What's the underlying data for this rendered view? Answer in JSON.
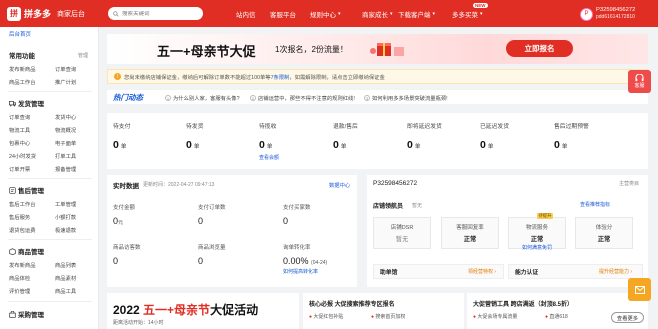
{
  "header": {
    "logo_mark": "拼",
    "logo_text": "拼多多",
    "logo_sub": "商家后台",
    "search_placeholder": "搜索关键词",
    "nav": [
      "站内信",
      "客服平台",
      "规则中心",
      "商家成长",
      "下载客户端",
      "多多买菜"
    ],
    "new_badge": "NEW",
    "user_name": "P32598456272",
    "user_sub": "pdd61614172810",
    "avatar": "P"
  },
  "sidebar": {
    "back_label": "后台首页",
    "manage_label": "管理",
    "common_title": "常用功能",
    "common_items": [
      "发布新商品",
      "订单查询",
      "商品工作台",
      "推广计划"
    ],
    "sections": [
      {
        "title": "发货管理",
        "items": [
          "订单查询",
          "发货中心",
          "物流工具",
          "物流概况",
          "包裹中心",
          "电子面单",
          "24小时发货",
          "打单工具",
          "订单开票",
          "报备管理"
        ]
      },
      {
        "title": "售后管理",
        "items": [
          "售后工作台",
          "工单管理",
          "售后服务",
          "小额打款",
          "退货包运费",
          "极速退款"
        ]
      },
      {
        "title": "商品管理",
        "items": [
          "发布新商品",
          "商品列表",
          "商品体检",
          "商品素材",
          "评价管理",
          "商品工具"
        ]
      },
      {
        "title": "采购管理",
        "items": []
      }
    ]
  },
  "banner": {
    "title": "五一+母亲节大促",
    "subtitle": "1次报名，2份流量！",
    "button": "立即报名"
  },
  "notice": {
    "text": "您尚未缴纳店铺保证金，缴纳后可解除订单数不能超过100单等",
    "link1": "7条限制",
    "mid": "，如需解除限制，请点击立即缴纳保证金",
    "link2": "立即缴纳保证金"
  },
  "hot": {
    "label": "热门动态",
    "items": [
      "为什么别人家，客服有头像?",
      "店铺运营中，那些不得不注意的规则红线!",
      "如何利用多多场景突破流量瓶颈!"
    ]
  },
  "stats": [
    {
      "label": "待支付",
      "value": "0",
      "unit": "单"
    },
    {
      "label": "待发货",
      "value": "0",
      "unit": "单"
    },
    {
      "label": "待揽收",
      "value": "0",
      "unit": "单",
      "link": "查看会额"
    },
    {
      "label": "退款/售后",
      "value": "0",
      "unit": "单"
    },
    {
      "label": "即将延迟发货",
      "value": "0",
      "unit": "单"
    },
    {
      "label": "已延迟发货",
      "value": "0",
      "unit": "单"
    },
    {
      "label": "售后过期预警",
      "value": "0",
      "unit": "单"
    }
  ],
  "realtime": {
    "title": "实时数据",
    "updated": "更新时间：2022-04-27 09:47:13",
    "link": "数据中心",
    "cells": [
      {
        "label": "支付金额",
        "value": "0",
        "unit": "元"
      },
      {
        "label": "支付订单数",
        "value": "0",
        "unit": ""
      },
      {
        "label": "支付买家数",
        "value": "0",
        "unit": ""
      },
      {
        "label": "商品访客数",
        "value": "0",
        "unit": ""
      },
      {
        "label": "商品浏览量",
        "value": "0",
        "unit": ""
      },
      {
        "label": "询单转化率",
        "value": "0.00%",
        "unit": "(04-24)",
        "link": "如何提高转化率"
      }
    ]
  },
  "shop": {
    "account": "P32598456272",
    "account_tag": "主营类目",
    "sub_title": "店铺领航员",
    "sub_note": "暂无",
    "sub_link": "查看推荐指标",
    "scores": [
      {
        "title": "店铺DSR",
        "value": "暂无",
        "gray": true
      },
      {
        "title": "客服回复率",
        "value": "正常"
      },
      {
        "title": "物流服务",
        "value": "正常",
        "link": "如何满意免罚",
        "tag": "待提升"
      },
      {
        "title": "体验分",
        "value": "正常"
      }
    ],
    "row1": {
      "label": "助单馆",
      "link": "领经营特权 ›"
    },
    "row2": {
      "label": "能力认证",
      "link": "提升经营能力 ›"
    }
  },
  "promo": {
    "year": "2022",
    "title": "五一+母亲节",
    "title2": "大促活动",
    "sub": "距离活动开始：14小时"
  },
  "promo_boxes": [
    {
      "title": "核心必报 大促搜索推荐专区报名",
      "items": [
        "大促红包补贴",
        "搜索首页加权"
      ]
    },
    {
      "title": "大促营销工具 跨店满返（封顶8.5折）",
      "items": [
        "大促会场专属流量",
        "直通618"
      ],
      "button": "查看更多"
    }
  ],
  "float": {
    "kefu": "客服"
  }
}
